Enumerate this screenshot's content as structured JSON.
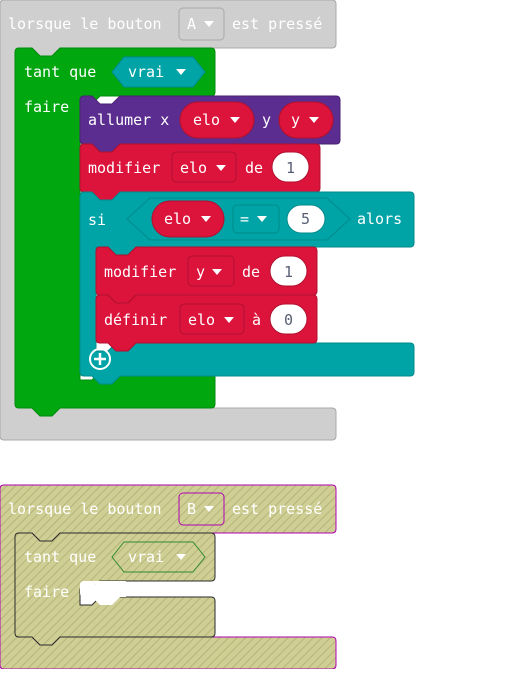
{
  "blocks": {
    "event_a": {
      "prefix": "lorsque le bouton",
      "button_value": "A",
      "suffix": "est pressé"
    },
    "while_loop": {
      "label": "tant que",
      "condition": "vrai",
      "do_label": "faire"
    },
    "plot": {
      "label": "allumer x",
      "x_var": "elo",
      "y_label": "y",
      "y_var": "y"
    },
    "change_elo": {
      "label": "modifier",
      "var": "elo",
      "by_label": "de",
      "value": "1"
    },
    "if_block": {
      "label": "si",
      "left_var": "elo",
      "operator": "=",
      "right_value": "5",
      "then_label": "alors"
    },
    "change_y": {
      "label": "modifier",
      "var": "y",
      "by_label": "de",
      "value": "1"
    },
    "set_elo": {
      "label": "définir",
      "var": "elo",
      "to_label": "à",
      "value": "0"
    },
    "event_b": {
      "prefix": "lorsque le bouton",
      "button_value": "B",
      "suffix": "est pressé",
      "disabled": true
    },
    "while_loop_b": {
      "label": "tant que",
      "condition": "vrai",
      "do_label": "faire"
    }
  },
  "colors": {
    "event_gray": "#cfcfcf",
    "event_border": "#a7a7a7",
    "loops_green": "#00a70f",
    "loops_dark": "#008a0c",
    "logic_teal": "#00a4a6",
    "logic_dark": "#008a8c",
    "variables_red": "#dc143c",
    "variables_dark": "#b0102f",
    "led_purple": "#5c2d91",
    "disabled_fill": "#c6c18a",
    "disabled_border": "#b000b0"
  }
}
